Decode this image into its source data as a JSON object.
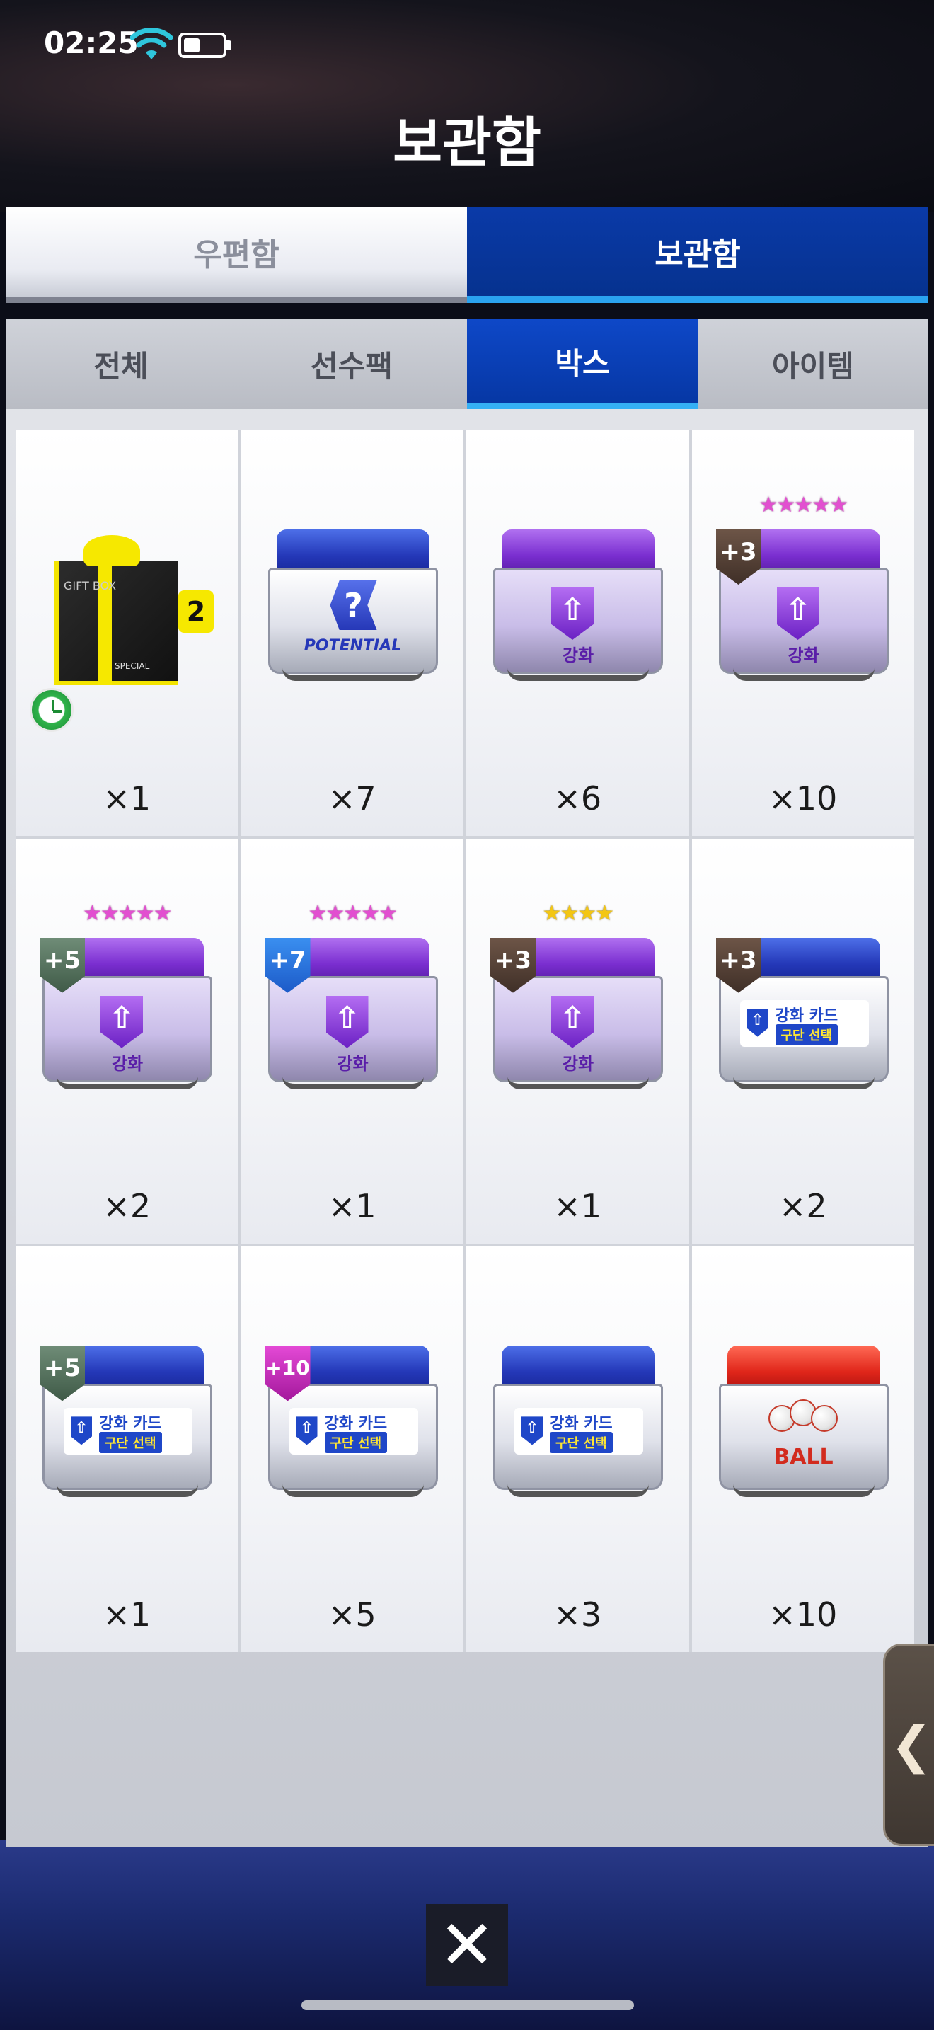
{
  "status": {
    "time": "02:25"
  },
  "title": "보관함",
  "main_tabs": [
    {
      "label": "우편함",
      "active": false
    },
    {
      "label": "보관함",
      "active": true
    }
  ],
  "sub_tabs": [
    {
      "label": "전체",
      "active": false
    },
    {
      "label": "선수팩",
      "active": false
    },
    {
      "label": "박스",
      "active": true
    },
    {
      "label": "아이템",
      "active": false
    }
  ],
  "items": [
    {
      "type": "gift",
      "count": "×1",
      "art": {
        "tag": "2",
        "line1": "GIFT BOX",
        "line2": "SPECIAL"
      },
      "timer": true
    },
    {
      "type": "potential",
      "count": "×7",
      "art": {
        "label": "POTENTIAL",
        "glyph": "?"
      }
    },
    {
      "type": "enhance",
      "count": "×6",
      "art": {
        "label": "강화"
      }
    },
    {
      "type": "enhance",
      "count": "×10",
      "stars": "★★★★★",
      "star_color": "pink",
      "level": "+3",
      "level_style": "brown",
      "art": {
        "label": "강화"
      }
    },
    {
      "type": "enhance",
      "count": "×2",
      "stars": "★★★★★",
      "star_color": "pink",
      "level": "+5",
      "level_style": "green",
      "art": {
        "label": "강화"
      }
    },
    {
      "type": "enhance",
      "count": "×1",
      "stars": "★★★★★",
      "star_color": "pink",
      "level": "+7",
      "level_style": "blue",
      "art": {
        "label": "강화"
      }
    },
    {
      "type": "enhance",
      "count": "×1",
      "stars": "★★★★",
      "star_color": "gold",
      "level": "+3",
      "level_style": "brown",
      "art": {
        "label": "강화"
      }
    },
    {
      "type": "card",
      "count": "×2",
      "level": "+3",
      "level_style": "brown",
      "art": {
        "line1": "강화 카드",
        "line2": "구단 선택"
      }
    },
    {
      "type": "card",
      "count": "×1",
      "level": "+5",
      "level_style": "green",
      "art": {
        "line1": "강화 카드",
        "line2": "구단 선택"
      }
    },
    {
      "type": "card",
      "count": "×5",
      "level": "+10",
      "level_style": "pink",
      "art": {
        "line1": "강화 카드",
        "line2": "구단 선택"
      }
    },
    {
      "type": "card",
      "count": "×3",
      "art": {
        "line1": "강화 카드",
        "line2": "구단 선택"
      }
    },
    {
      "type": "ball",
      "count": "×10",
      "art": {
        "label": "BALL"
      }
    }
  ],
  "side_handle": {
    "glyph": "❮"
  },
  "close": {
    "glyph": "✕"
  }
}
